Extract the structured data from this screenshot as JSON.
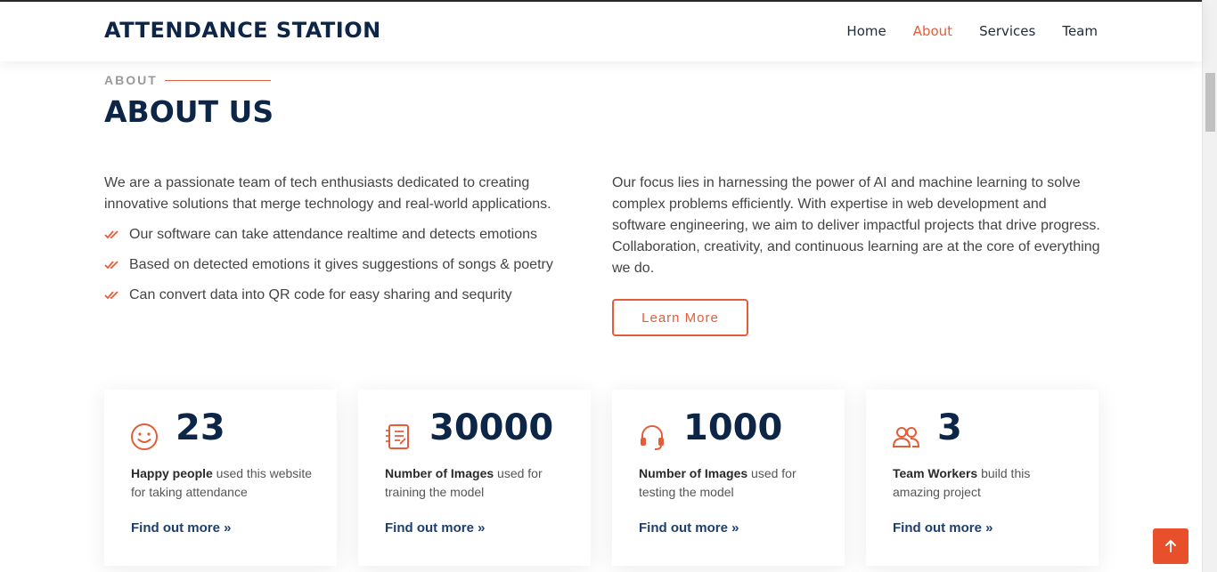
{
  "header": {
    "logo": "ATTENDANCE STATION",
    "nav": [
      {
        "label": "Home",
        "active": false
      },
      {
        "label": "About",
        "active": true
      },
      {
        "label": "Services",
        "active": false
      },
      {
        "label": "Team",
        "active": false
      }
    ]
  },
  "about": {
    "tag": "ABOUT",
    "title": "ABOUT US",
    "intro": "We are a passionate team of tech enthusiasts dedicated to creating innovative solutions that merge technology and real-world applications.",
    "checklist": [
      "Our software can take attendance realtime and detects emotions",
      "Based on detected emotions it gives suggestions of songs & poetry",
      "Can convert data into QR code for easy sharing and sequrity"
    ],
    "focus": "Our focus lies in harnessing the power of AI and machine learning to solve complex problems efficiently. With expertise in web development and software engineering, we aim to deliver impactful projects that drive progress. Collaboration, creativity, and continuous learning are at the core of everything we do.",
    "learn_more": "Learn More"
  },
  "stats": [
    {
      "icon": "smiley-icon",
      "number": "23",
      "bold": "Happy people",
      "rest": " used this website for taking attendance",
      "link": "Find out more »"
    },
    {
      "icon": "document-list-icon",
      "number": "30000",
      "bold": "Number of Images",
      "rest": " used for training the model",
      "link": "Find out more »"
    },
    {
      "icon": "headset-icon",
      "number": "1000",
      "bold": "Number of Images",
      "rest": " used for testing the model",
      "link": "Find out more »"
    },
    {
      "icon": "people-icon",
      "number": "3",
      "bold": "Team Workers",
      "rest": " build this amazing project",
      "link": "Find out more »"
    }
  ],
  "colors": {
    "accent": "#e35d3a",
    "navy": "#0d2547",
    "link": "#1d3f6e"
  },
  "back_to_top_icon": "arrow-up-icon"
}
